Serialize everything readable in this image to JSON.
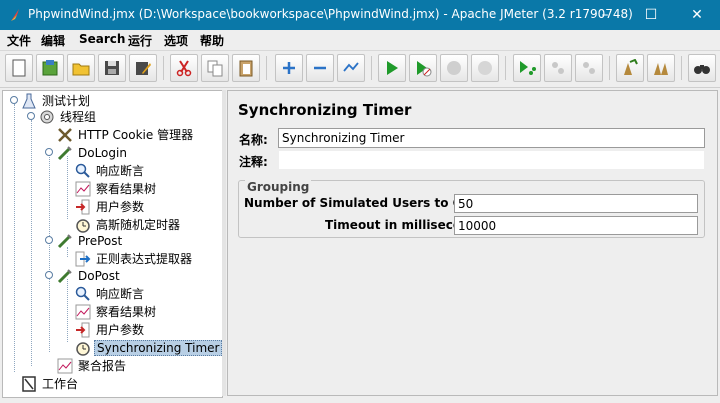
{
  "window": {
    "title": "PhpwindWind.jmx (D:\\Workspace\\bookworkspace\\PhpwindWind.jmx) - Apache JMeter (3.2 r1790748)",
    "controls": [
      "–",
      "☐",
      "✕"
    ],
    "accent_color": "#0a78a8"
  },
  "menu": [
    "文件",
    "编辑",
    "Search",
    "运行",
    "选项",
    "帮助"
  ],
  "toolbar": {
    "buttons": [
      "new-icon",
      "templates-icon",
      "open-icon",
      "save-icon",
      "save-as-icon",
      "cut-icon",
      "copy-icon",
      "paste-icon",
      "expand-icon",
      "collapse-icon",
      "toggle-icon",
      "start-icon",
      "start-no-timers-icon",
      "stop-icon",
      "shutdown-icon",
      "remote-start-icon",
      "remote-stop-icon",
      "remote-shutdown-icon",
      "clear-icon",
      "clear-all-icon",
      "search-icon"
    ]
  },
  "tree": {
    "nodes": [
      {
        "label": "测试计划",
        "icon": "test-plan-icon"
      },
      {
        "label": "线程组",
        "icon": "thread-group-icon"
      },
      {
        "label": "HTTP Cookie 管理器",
        "icon": "cookie-manager-icon"
      },
      {
        "label": "DoLogin",
        "icon": "sampler-icon"
      },
      {
        "label": "响应断言",
        "icon": "assertion-icon"
      },
      {
        "label": "察看结果树",
        "icon": "listener-icon"
      },
      {
        "label": "用户参数",
        "icon": "preprocessor-icon"
      },
      {
        "label": "高斯随机定时器",
        "icon": "timer-icon"
      },
      {
        "label": "PrePost",
        "icon": "sampler-icon"
      },
      {
        "label": "正则表达式提取器",
        "icon": "postprocessor-icon"
      },
      {
        "label": "DoPost",
        "icon": "sampler-icon"
      },
      {
        "label": "响应断言",
        "icon": "assertion-icon"
      },
      {
        "label": "察看结果树",
        "icon": "listener-icon"
      },
      {
        "label": "用户参数",
        "icon": "preprocessor-icon"
      },
      {
        "label": "Synchronizing Timer",
        "icon": "timer-icon"
      },
      {
        "label": "聚合报告",
        "icon": "listener-icon"
      },
      {
        "label": "工作台",
        "icon": "workbench-icon"
      }
    ]
  },
  "panel": {
    "title": "Synchronizing Timer",
    "name_label": "名称:",
    "name_value": "Synchronizing Timer",
    "comment_label": "注释:",
    "comment_value": "",
    "grouping": {
      "legend": "Grouping",
      "users_label": "Number of Simulated Users to Group by:",
      "users_value": "50",
      "timeout_label": "Timeout in milliseconds:",
      "timeout_value": "10000"
    }
  }
}
